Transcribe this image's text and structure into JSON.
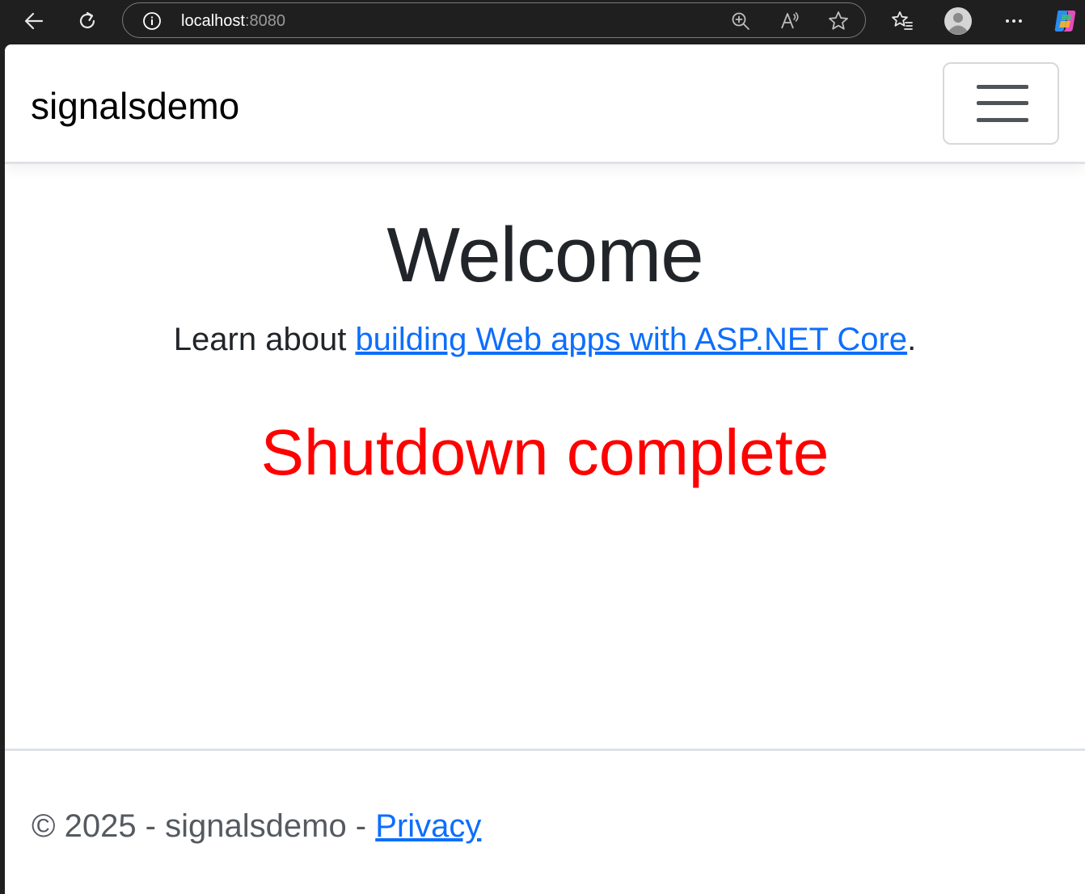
{
  "browser": {
    "address": {
      "host": "localhost",
      "port": ":8080"
    },
    "icons": {
      "back": "back-arrow-icon",
      "refresh": "refresh-icon",
      "info": "info-icon",
      "zoom": "zoom-in-icon",
      "read_aloud": "read-aloud-icon",
      "favorite": "star-icon",
      "favorites": "favorites-list-icon",
      "profile": "profile-avatar-icon",
      "more": "more-icon",
      "copilot": "copilot-icon"
    }
  },
  "navbar": {
    "brand": "signalsdemo",
    "toggler_icon": "hamburger-menu-icon"
  },
  "main": {
    "title": "Welcome",
    "learn_prefix": "Learn about ",
    "learn_link": "building Web apps with ASP.NET Core",
    "learn_suffix": ".",
    "status": "Shutdown complete"
  },
  "footer": {
    "text": "© 2025 - signalsdemo - ",
    "privacy_link": "Privacy"
  },
  "colors": {
    "link": "#0d6efd",
    "status": "#ff0000",
    "text": "#212529",
    "chrome_bg": "#1f1f1f"
  }
}
